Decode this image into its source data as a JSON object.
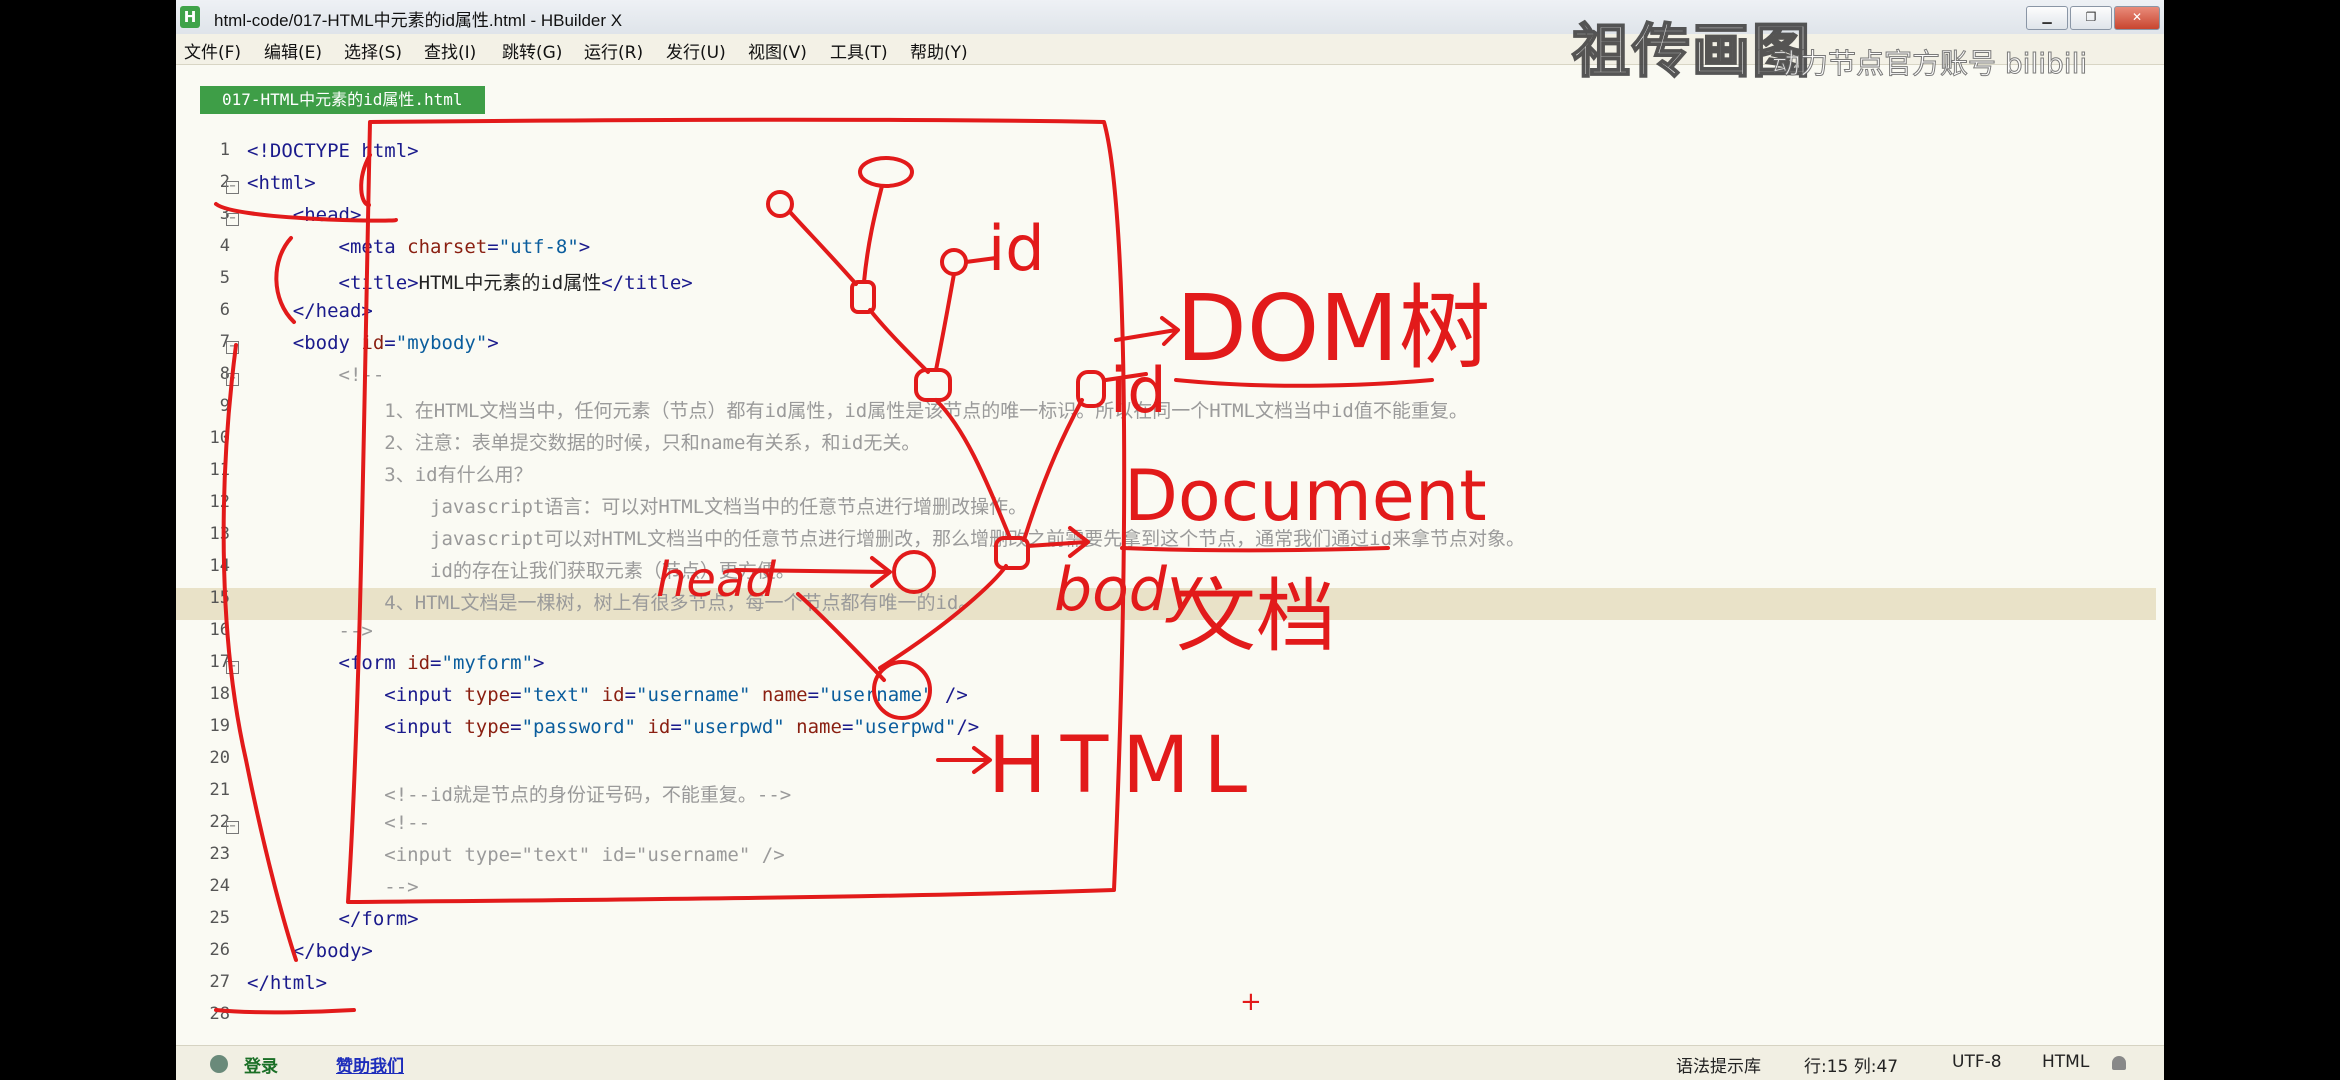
{
  "window": {
    "title": "html-code/017-HTML中元素的id属性.html - HBuilder X",
    "app_icon": "H",
    "minimize_icon": "minimize-icon",
    "maximize_icon": "maximize-icon",
    "close_icon": "close-icon"
  },
  "watermark": {
    "text": "祖传画图",
    "sub": "动力节点官方账号 bilibili"
  },
  "menu": [
    "文件(F)",
    "编辑(E)",
    "选择(S)",
    "查找(I)",
    "跳转(G)",
    "运行(R)",
    "发行(U)",
    "视图(V)",
    "工具(T)",
    "帮助(Y)"
  ],
  "tab": {
    "label": "017-HTML中元素的id属性.html"
  },
  "editor": {
    "highlight_line": 15,
    "lines": [
      {
        "n": "1",
        "fold": "",
        "code": [
          [
            "t",
            "<!DOCTYPE html>"
          ]
        ]
      },
      {
        "n": "2",
        "fold": "⊟",
        "code": [
          [
            "t",
            "<html>"
          ]
        ]
      },
      {
        "n": "3",
        "fold": "⊟",
        "code": [
          [
            "x",
            "    "
          ],
          [
            "t",
            "<head>"
          ]
        ]
      },
      {
        "n": "4",
        "fold": "",
        "code": [
          [
            "x",
            "        "
          ],
          [
            "t",
            "<meta "
          ],
          [
            "a",
            "charset"
          ],
          [
            "t",
            "="
          ],
          [
            "v",
            "\"utf-8\""
          ],
          [
            "t",
            ">"
          ]
        ]
      },
      {
        "n": "5",
        "fold": "",
        "code": [
          [
            "x",
            "        "
          ],
          [
            "t",
            "<title>"
          ],
          [
            "x",
            "HTML中元素的id属性"
          ],
          [
            "t",
            "</title>"
          ]
        ]
      },
      {
        "n": "6",
        "fold": "",
        "code": [
          [
            "x",
            "    "
          ],
          [
            "t",
            "</head>"
          ]
        ]
      },
      {
        "n": "7",
        "fold": "⊟",
        "code": [
          [
            "x",
            "    "
          ],
          [
            "t",
            "<body "
          ],
          [
            "a",
            "id"
          ],
          [
            "t",
            "="
          ],
          [
            "v",
            "\"mybody\""
          ],
          [
            "t",
            ">"
          ]
        ]
      },
      {
        "n": "8",
        "fold": "⊟",
        "code": [
          [
            "c",
            "        <!--"
          ]
        ]
      },
      {
        "n": "9",
        "fold": "",
        "code": [
          [
            "c",
            "            1、在HTML文档当中，任何元素（节点）都有id属性，id属性是该节点的唯一标识。所以在同一个HTML文档当中id值不能重复。"
          ]
        ]
      },
      {
        "n": "10",
        "fold": "",
        "code": [
          [
            "c",
            "            2、注意：表单提交数据的时候，只和name有关系，和id无关。"
          ]
        ]
      },
      {
        "n": "11",
        "fold": "",
        "code": [
          [
            "c",
            "            3、id有什么用？"
          ]
        ]
      },
      {
        "n": "12",
        "fold": "",
        "code": [
          [
            "c",
            "                javascript语言：可以对HTML文档当中的任意节点进行增删改操作。"
          ]
        ]
      },
      {
        "n": "13",
        "fold": "",
        "code": [
          [
            "c",
            "                javascript可以对HTML文档当中的任意节点进行增删改，那么增删改之前需要先拿到这个节点，通常我们通过id来拿节点对象。"
          ]
        ]
      },
      {
        "n": "14",
        "fold": "",
        "code": [
          [
            "c",
            "                id的存在让我们获取元素（节点）更方便。"
          ]
        ]
      },
      {
        "n": "15",
        "fold": "",
        "code": [
          [
            "c",
            "            4、HTML文档是一棵树，树上有很多节点，每一个节点都有唯一的id。"
          ]
        ]
      },
      {
        "n": "16",
        "fold": "",
        "code": [
          [
            "c",
            "        -->"
          ]
        ]
      },
      {
        "n": "17",
        "fold": "⊟",
        "code": [
          [
            "x",
            "        "
          ],
          [
            "t",
            "<form "
          ],
          [
            "a",
            "id"
          ],
          [
            "t",
            "="
          ],
          [
            "v",
            "\"myform\""
          ],
          [
            "t",
            ">"
          ]
        ]
      },
      {
        "n": "18",
        "fold": "",
        "code": [
          [
            "x",
            "            "
          ],
          [
            "t",
            "<input "
          ],
          [
            "a",
            "type"
          ],
          [
            "t",
            "="
          ],
          [
            "v",
            "\"text\""
          ],
          [
            "x",
            " "
          ],
          [
            "a",
            "id"
          ],
          [
            "t",
            "="
          ],
          [
            "v",
            "\"username\""
          ],
          [
            "x",
            " "
          ],
          [
            "a",
            "name"
          ],
          [
            "t",
            "="
          ],
          [
            "v",
            "\"username\""
          ],
          [
            "t",
            " />"
          ]
        ]
      },
      {
        "n": "19",
        "fold": "",
        "code": [
          [
            "x",
            "            "
          ],
          [
            "t",
            "<input "
          ],
          [
            "a",
            "type"
          ],
          [
            "t",
            "="
          ],
          [
            "v",
            "\"password\""
          ],
          [
            "x",
            " "
          ],
          [
            "a",
            "id"
          ],
          [
            "t",
            "="
          ],
          [
            "v",
            "\"userpwd\""
          ],
          [
            "x",
            " "
          ],
          [
            "a",
            "name"
          ],
          [
            "t",
            "="
          ],
          [
            "v",
            "\"userpwd\""
          ],
          [
            "t",
            "/>"
          ]
        ]
      },
      {
        "n": "20",
        "fold": "",
        "code": []
      },
      {
        "n": "21",
        "fold": "",
        "code": [
          [
            "c",
            "            <!--id就是节点的身份证号码，不能重复。-->"
          ]
        ]
      },
      {
        "n": "22",
        "fold": "⊟",
        "code": [
          [
            "c",
            "            <!--"
          ]
        ]
      },
      {
        "n": "23",
        "fold": "",
        "code": [
          [
            "c",
            "            <input type=\"text\" id=\"username\" />"
          ]
        ]
      },
      {
        "n": "24",
        "fold": "",
        "code": [
          [
            "c",
            "            -->"
          ]
        ]
      },
      {
        "n": "25",
        "fold": "",
        "code": [
          [
            "x",
            "        "
          ],
          [
            "t",
            "</form>"
          ]
        ]
      },
      {
        "n": "26",
        "fold": "",
        "code": [
          [
            "x",
            "    "
          ],
          [
            "t",
            "</body>"
          ]
        ]
      },
      {
        "n": "27",
        "fold": "",
        "code": [
          [
            "t",
            "</html>"
          ]
        ]
      },
      {
        "n": "28",
        "fold": "",
        "code": []
      }
    ]
  },
  "annotations": {
    "labels": [
      "id",
      "id",
      "body",
      "head",
      "HTML",
      "DOM树",
      "Document",
      "文档"
    ],
    "arrow": "→",
    "cross": "+",
    "color": "#e21a1a"
  },
  "status": {
    "login": "登录",
    "sponsor": "赞助我们",
    "syntax_lib": "语法提示库",
    "cursor": "行:15  列:47",
    "encoding": "UTF-8",
    "language": "HTML"
  }
}
